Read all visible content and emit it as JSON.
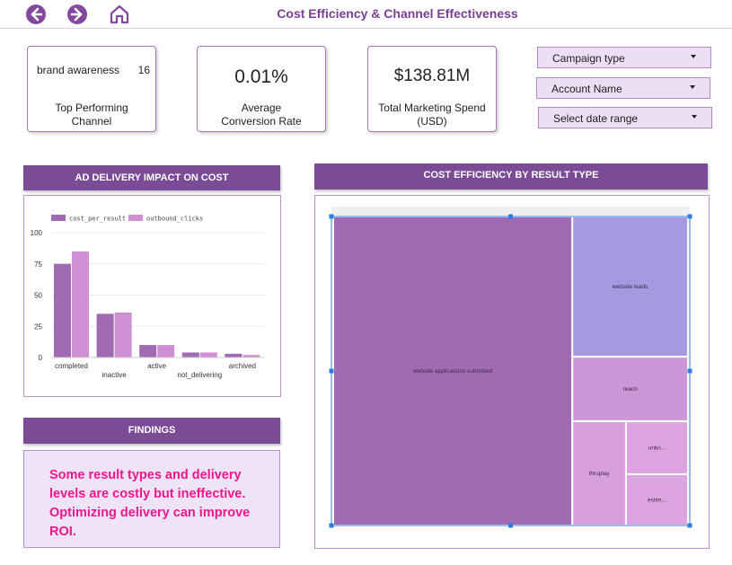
{
  "header": {
    "title": "Cost Efficiency & Channel Effectiveness"
  },
  "kpis": {
    "top_channel": {
      "name": "brand awareness",
      "count": "16",
      "label": "Top Performing Channel"
    },
    "avg_conversion": {
      "value": "0.01%",
      "label": "Average Conversion Rate"
    },
    "total_spend": {
      "value": "$138.81M",
      "label": "Total Marketing Spend (USD)"
    }
  },
  "filters": [
    {
      "label": "Campaign type"
    },
    {
      "label": "Account Name"
    },
    {
      "label": "Select date range"
    }
  ],
  "sections": {
    "ad_delivery": "AD DELIVERY IMPACT ON COST",
    "cost_efficiency": "COST EFFICIENCY BY RESULT TYPE",
    "findings": "FINDINGS"
  },
  "findings_text": "Some result types and delivery levels are costly but ineffective. Optimizing delivery can improve ROI.",
  "colors": {
    "accent": "#7b4b96",
    "series_cost": "#a06bb2",
    "series_clicks": "#d08fd3",
    "findings_text": "#f0168e"
  },
  "chart_data": [
    {
      "type": "bar",
      "categories": [
        "completed",
        "inactive",
        "active",
        "not_delivering",
        "archived"
      ],
      "series": [
        {
          "name": "cost_per_result",
          "values": [
            75,
            35,
            10,
            4,
            3
          ]
        },
        {
          "name": "outbound_clicks",
          "values": [
            85,
            36,
            10,
            4,
            2
          ]
        }
      ],
      "title": "",
      "xlabel": "",
      "ylabel": "",
      "ylim": [
        0,
        100
      ],
      "yticks": [
        0,
        25,
        50,
        75,
        100
      ],
      "grid": true,
      "legend": "top-left"
    },
    {
      "type": "treemap",
      "items": [
        {
          "label": "website applications submitted",
          "value": 67.4,
          "color": "#a06bb2"
        },
        {
          "label": "website leads",
          "value": 14.8,
          "color": "#a599e0"
        },
        {
          "label": "reach",
          "value": 6.8,
          "color": "#cd96d7"
        },
        {
          "label": "thruplay",
          "value": 5.1,
          "color": "#d79fde"
        },
        {
          "label": "unkn...",
          "value": 3.0,
          "color": "#dca5e1"
        },
        {
          "label": "estim...",
          "value": 2.9,
          "color": "#dca5e1"
        }
      ]
    }
  ]
}
